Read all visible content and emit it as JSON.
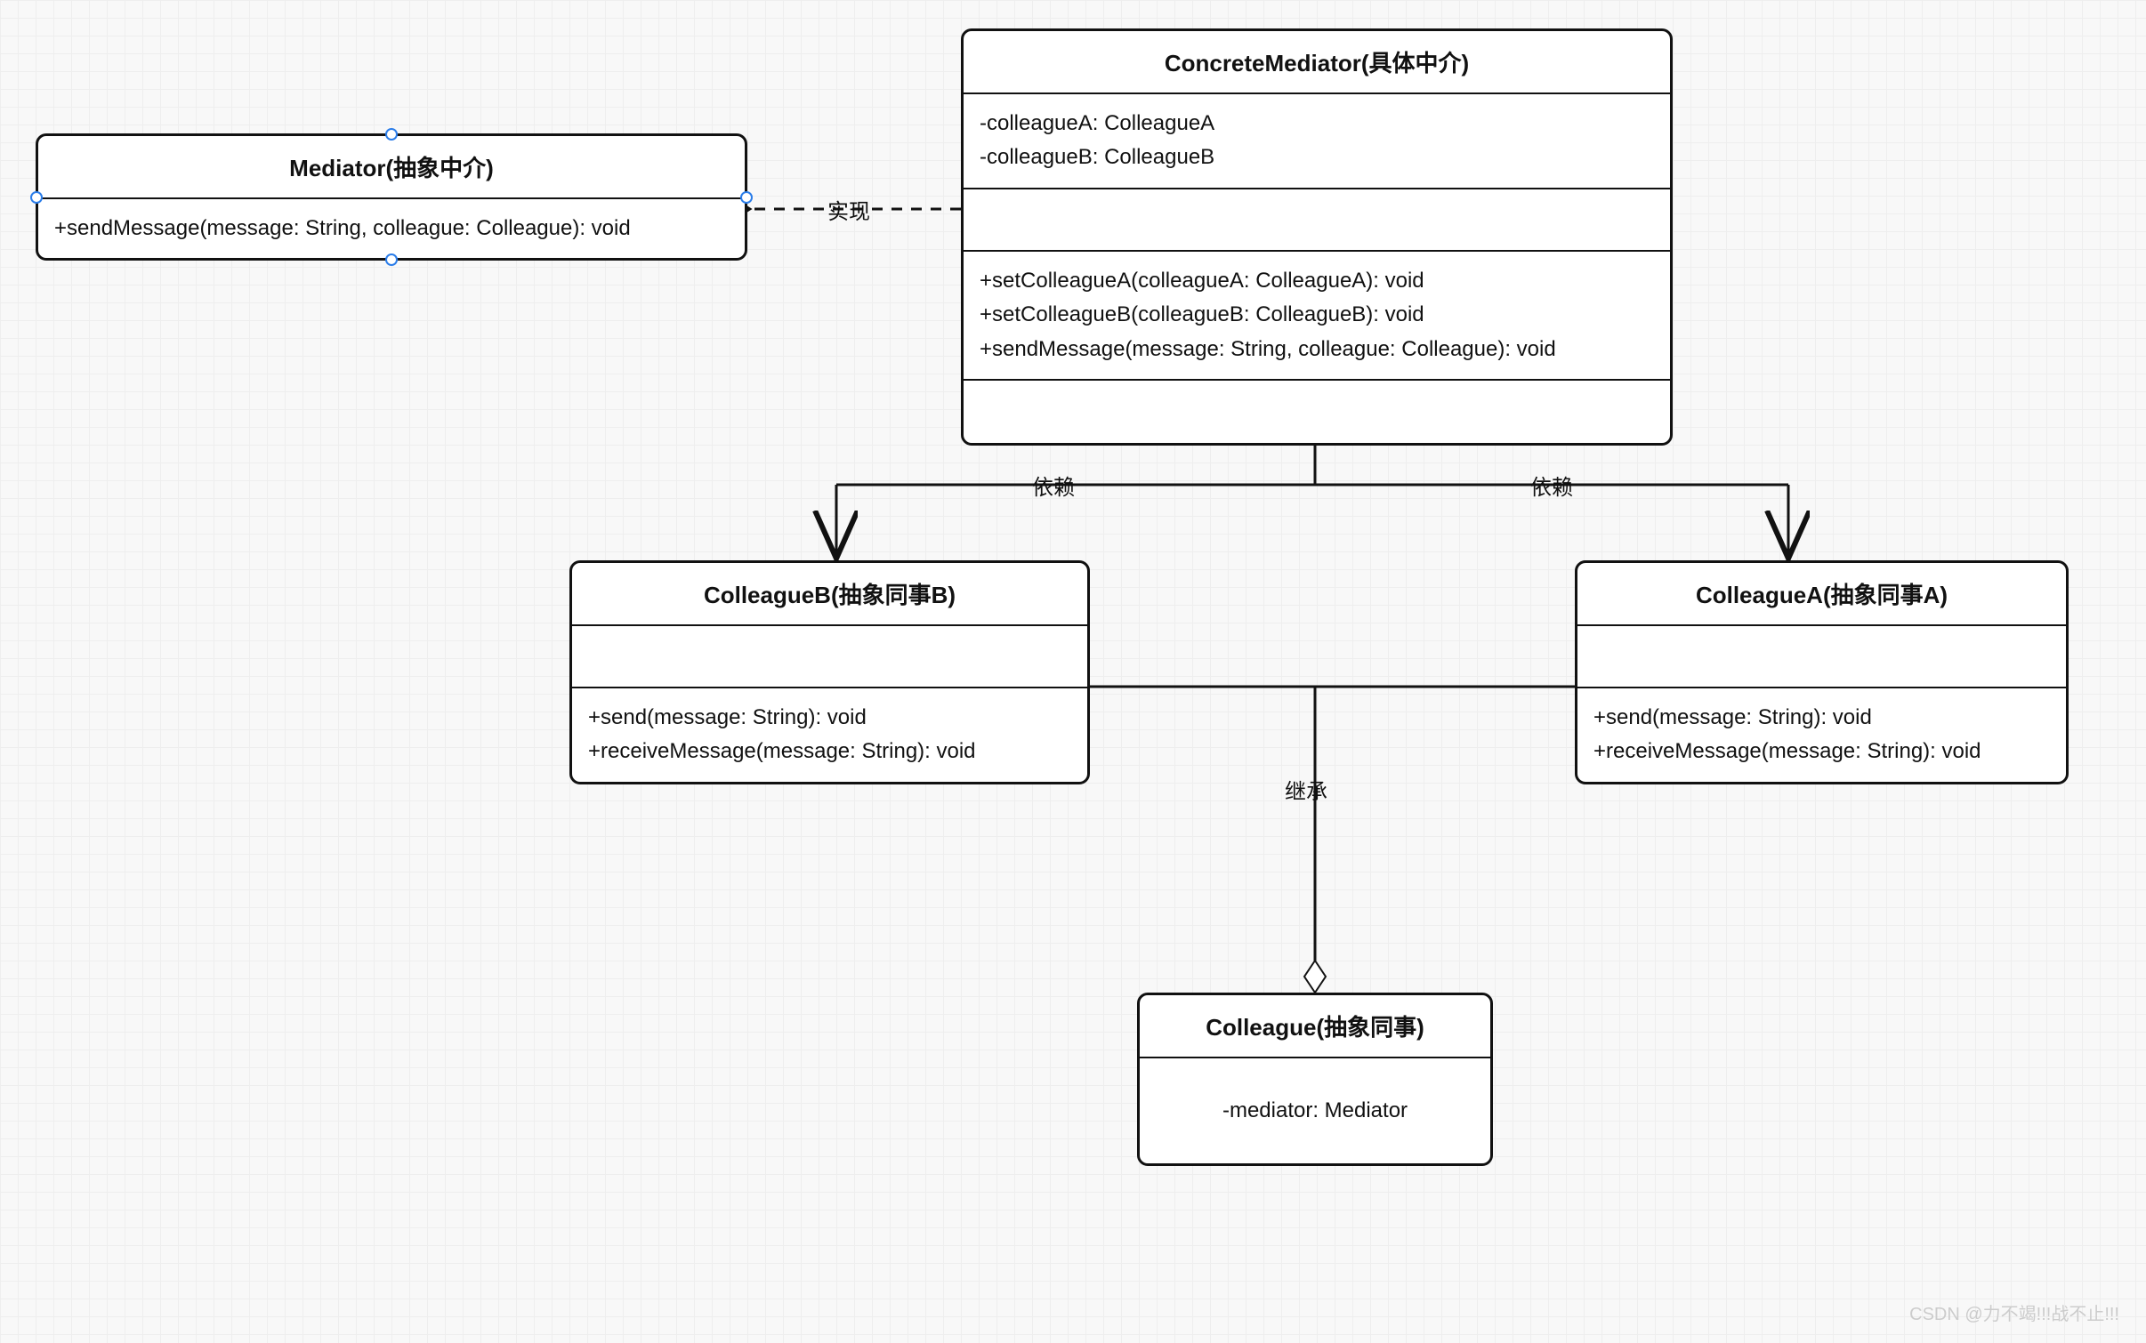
{
  "classes": {
    "mediator": {
      "title": "Mediator(抽象中介)",
      "methods": [
        "+sendMessage(message: String, colleague: Colleague): void"
      ]
    },
    "concreteMediator": {
      "title": "ConcreteMediator(具体中介)",
      "attributes": [
        "-colleagueA: ColleagueA",
        "-colleagueB: ColleagueB"
      ],
      "methods": [
        "+setColleagueA(colleagueA: ColleagueA): void",
        "+setColleagueB(colleagueB: ColleagueB): void",
        "+sendMessage(message: String, colleague: Colleague): void"
      ]
    },
    "colleagueB": {
      "title": "ColleagueB(抽象同事B)",
      "methods": [
        "+send(message: String): void",
        "+receiveMessage(message: String): void"
      ]
    },
    "colleagueA": {
      "title": "ColleagueA(抽象同事A)",
      "methods": [
        "+send(message: String): void",
        "+receiveMessage(message: String): void"
      ]
    },
    "colleague": {
      "title": "Colleague(抽象同事)",
      "attributes": [
        "-mediator: Mediator"
      ]
    }
  },
  "relations": {
    "realization": "实现",
    "dependency1": "依赖",
    "dependency2": "依赖",
    "inheritance": "继承"
  },
  "watermark": "CSDN @力不竭!!!战不止!!!"
}
